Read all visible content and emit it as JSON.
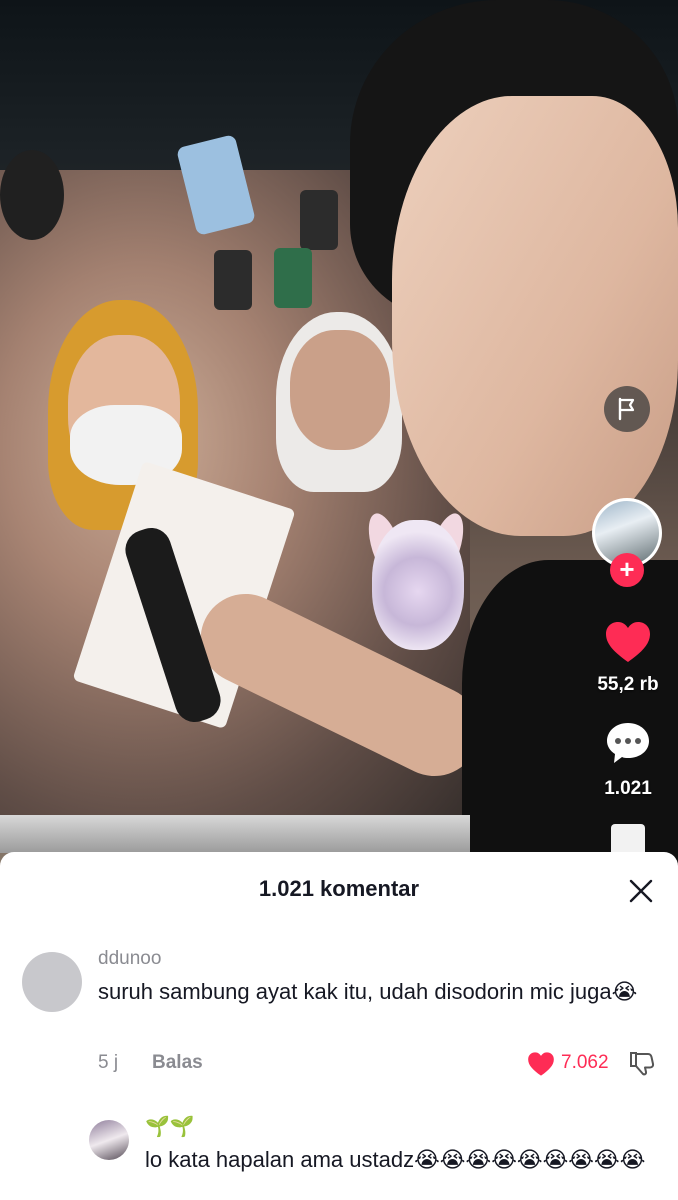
{
  "video": {
    "side_actions": {
      "likes": "55,2 rb",
      "comments": "1.021"
    }
  },
  "comments_sheet": {
    "title": "1.021 komentar",
    "comments": [
      {
        "username": "ddunoo",
        "text": "suruh sambung ayat kak itu, udah disodorin mic juga😭",
        "time": "5 j",
        "reply_label": "Balas",
        "likes": "7.062"
      },
      {
        "username": "🌱🌱",
        "text": "lo kata hapalan ama ustadz😭😭😭😭😭😭😭😭😭"
      }
    ]
  },
  "colors": {
    "accent": "#fe2c55",
    "sheet_bg": "#ffffff",
    "muted_text": "#8a8b91"
  },
  "icons": [
    "flag-icon",
    "plus-icon",
    "heart-icon",
    "comment-bubble-icon",
    "close-icon",
    "dislike-icon"
  ]
}
